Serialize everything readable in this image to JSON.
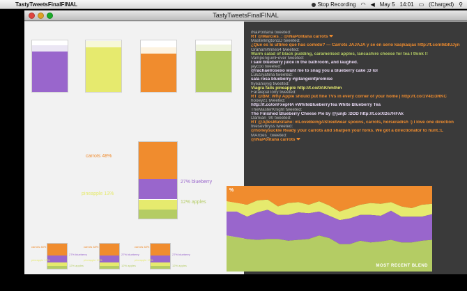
{
  "menubar": {
    "app_name": "TastyTweetsFinalFINAL",
    "stop_recording": "Stop Recording",
    "date": "May 5",
    "time": "14:01",
    "battery": "(Charged)"
  },
  "window": {
    "title": "TastyTweetsFinalFINAL"
  },
  "colors": {
    "blueberry": "#9966cc",
    "pineapple": "#e6ea6e",
    "carrots": "#f08c2e",
    "apples": "#b4cc64",
    "panel_bg": "#3a3a3a"
  },
  "glasses": [
    {
      "flavor": "blueberry",
      "fill_pct": 0.78,
      "color": "#9966cc",
      "foam": "#ebe6f4"
    },
    {
      "flavor": "pineapple",
      "fill_pct": 0.86,
      "color": "#e6ea6e",
      "foam": "#f7f8d8"
    },
    {
      "flavor": "carrots",
      "fill_pct": 0.74,
      "color": "#f08c2e",
      "foam": "#fdf3e0"
    },
    {
      "flavor": "apples",
      "fill_pct": 0.8,
      "color": "#b4cc64",
      "foam": "#eff4dd"
    }
  ],
  "blend": {
    "segments": [
      {
        "name": "carrots",
        "pct": 48,
        "label": "carrots 48%",
        "color": "#f08c2e"
      },
      {
        "name": "blueberry",
        "pct": 27,
        "label": "27% blueberry",
        "color": "#9966cc"
      },
      {
        "name": "pineapple",
        "pct": 13,
        "label": "pineapple 13%",
        "color": "#e6ea6e"
      },
      {
        "name": "apples",
        "pct": 12,
        "label": "12% apples",
        "color": "#b4cc64"
      }
    ]
  },
  "mini_blends": [
    {
      "labels": [
        "carrots 48%",
        "27% blueberry",
        "pineapple 13%",
        "12% apples"
      ]
    },
    {
      "labels": [
        "carrots 48%",
        "27% blueberry",
        "pineapple 13%",
        "12% apples"
      ]
    },
    {
      "labels": [
        "carrots 48%",
        "27% blueberry",
        "pineapple 13%",
        "12% apples"
      ]
    }
  ],
  "tweets": [
    {
      "user": "iNaPolitana tweeted:",
      "text": "RT @Marcies_: @iNaPolitana carrots  ❤",
      "color": "#f08c2e"
    },
    {
      "user": "Mastellington1D tweeted:",
      "text": "¿Que es lo ultimo que has comido? — Carrots JAJAJA y se en serio kasjkasjas http://t.co/nlkbIUJyn",
      "color": "#f08c2e"
    },
    {
      "user": "GrahamWines4 tweeted:",
      "text": "Warm salad of black pudding, caramelised apples, lancashire cheese for tea I think !!",
      "color": "#b4cc64"
    },
    {
      "user": "VampenguinFever tweeted:",
      "text": "I saw blueberry juice in the bathroom, and laughed.",
      "color": "#e8d8f4"
    },
    {
      "user": "jaycoo tweeted:",
      "text": "@rachaelrosexo want me to snag you a blueberry cake ;D lol",
      "color": "#e8d8f4"
    },
    {
      "user": "LuluSyafiina tweeted:",
      "text": "sala rosa blueberry #gilangeinfpromise",
      "color": "#e8d8f4"
    },
    {
      "user": "hyeaniiyyg tweeted:",
      "text": "Viagra fails pineapple http://t.co/0AKhmthm",
      "color": "#e6ea6e"
    },
    {
      "user": "FaraiepalTony tweeted:",
      "text": "RT @BM: Why Apple should put fine TVs in every corner of your home | http://t.co/1V4Ei3RKC",
      "color": "#f08c2e"
    },
    {
      "user": "hooeyz1 tweeted:",
      "text": "http://t.co/onFxepHA #WhiteBlueberryTea White Blueberry Tea",
      "color": "#e8d8f4"
    },
    {
      "user": "TheMasterKnight tweeted:",
      "text": "The Finished Blueberry Cheese Pie by @junjb :DDD http://t.co/XDs7HFAk",
      "color": "#e8d8f4"
    },
    {
      "user": "Damian_90 tweeted:",
      "text": "RT @ApesMaSitahe: #ILoveBeingAStreetwear spoons, carrots, horseradish :) I love one direction",
      "color": "#f08c2e"
    },
    {
      "user": "fivesevbryss tweeted:",
      "text": "@honeysuckle Ready your carrots and sharpen your forks. We got a directionator to hunt.:L",
      "color": "#f08c2e"
    },
    {
      "user": "MArcies_ tweeted:",
      "text": "@iNaPolitana carrots  ❤",
      "color": "#f08c2e"
    }
  ],
  "recent_blend": {
    "pct_label": "%",
    "caption": "MOST RECENT BLEND",
    "x": [
      0,
      1,
      2,
      3,
      4,
      5,
      6,
      7,
      8,
      9,
      10,
      11,
      12,
      13,
      14,
      15,
      16,
      17,
      18,
      19,
      20
    ],
    "series": [
      {
        "name": "carrots",
        "color": "#f08c2e",
        "values": [
          18,
          20,
          22,
          17,
          16,
          24,
          20,
          19,
          22,
          18,
          23,
          30,
          26,
          22,
          20,
          21,
          19,
          24,
          26,
          22,
          21
        ]
      },
      {
        "name": "pineapple",
        "color": "#e6ea6e",
        "values": [
          12,
          10,
          14,
          14,
          12,
          10,
          14,
          12,
          10,
          12,
          12,
          10,
          12,
          12,
          14,
          14,
          10,
          12,
          10,
          14,
          12
        ]
      },
      {
        "name": "blueberry",
        "color": "#9966cc",
        "values": [
          28,
          30,
          26,
          32,
          34,
          28,
          30,
          32,
          30,
          28,
          26,
          28,
          30,
          30,
          32,
          30,
          34,
          30,
          30,
          28,
          30
        ]
      },
      {
        "name": "apples",
        "color": "#b4cc64",
        "values": [
          42,
          40,
          38,
          37,
          38,
          38,
          36,
          37,
          38,
          42,
          39,
          32,
          32,
          36,
          34,
          35,
          37,
          34,
          34,
          36,
          37
        ]
      }
    ]
  }
}
